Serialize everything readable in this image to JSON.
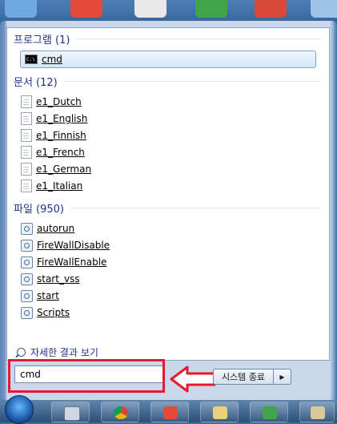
{
  "groups": {
    "programs": {
      "header": "프로그램 (1)",
      "items": [
        {
          "label": "cmd",
          "icon": "cmd-icon"
        }
      ]
    },
    "documents": {
      "header": "문서 (12)",
      "items": [
        {
          "label": "e1_Dutch"
        },
        {
          "label": "e1_English"
        },
        {
          "label": "e1_Finnish"
        },
        {
          "label": "e1_French"
        },
        {
          "label": "e1_German"
        },
        {
          "label": "e1_Italian"
        }
      ]
    },
    "files": {
      "header": "파일 (950)",
      "items": [
        {
          "label": "autorun"
        },
        {
          "label": "FireWallDisable"
        },
        {
          "label": "FireWallEnable"
        },
        {
          "label": "start_vss"
        },
        {
          "label": "start"
        },
        {
          "label": "Scripts"
        }
      ]
    }
  },
  "see_more": {
    "label": "자세한 결과 보기"
  },
  "search": {
    "value": "cmd"
  },
  "shutdown": {
    "label": "시스템 종료",
    "arrow": "▶"
  },
  "colors": {
    "highlight": "#e8192c",
    "header_text": "#1e3287"
  },
  "cmd_icon_text": "C:\\"
}
